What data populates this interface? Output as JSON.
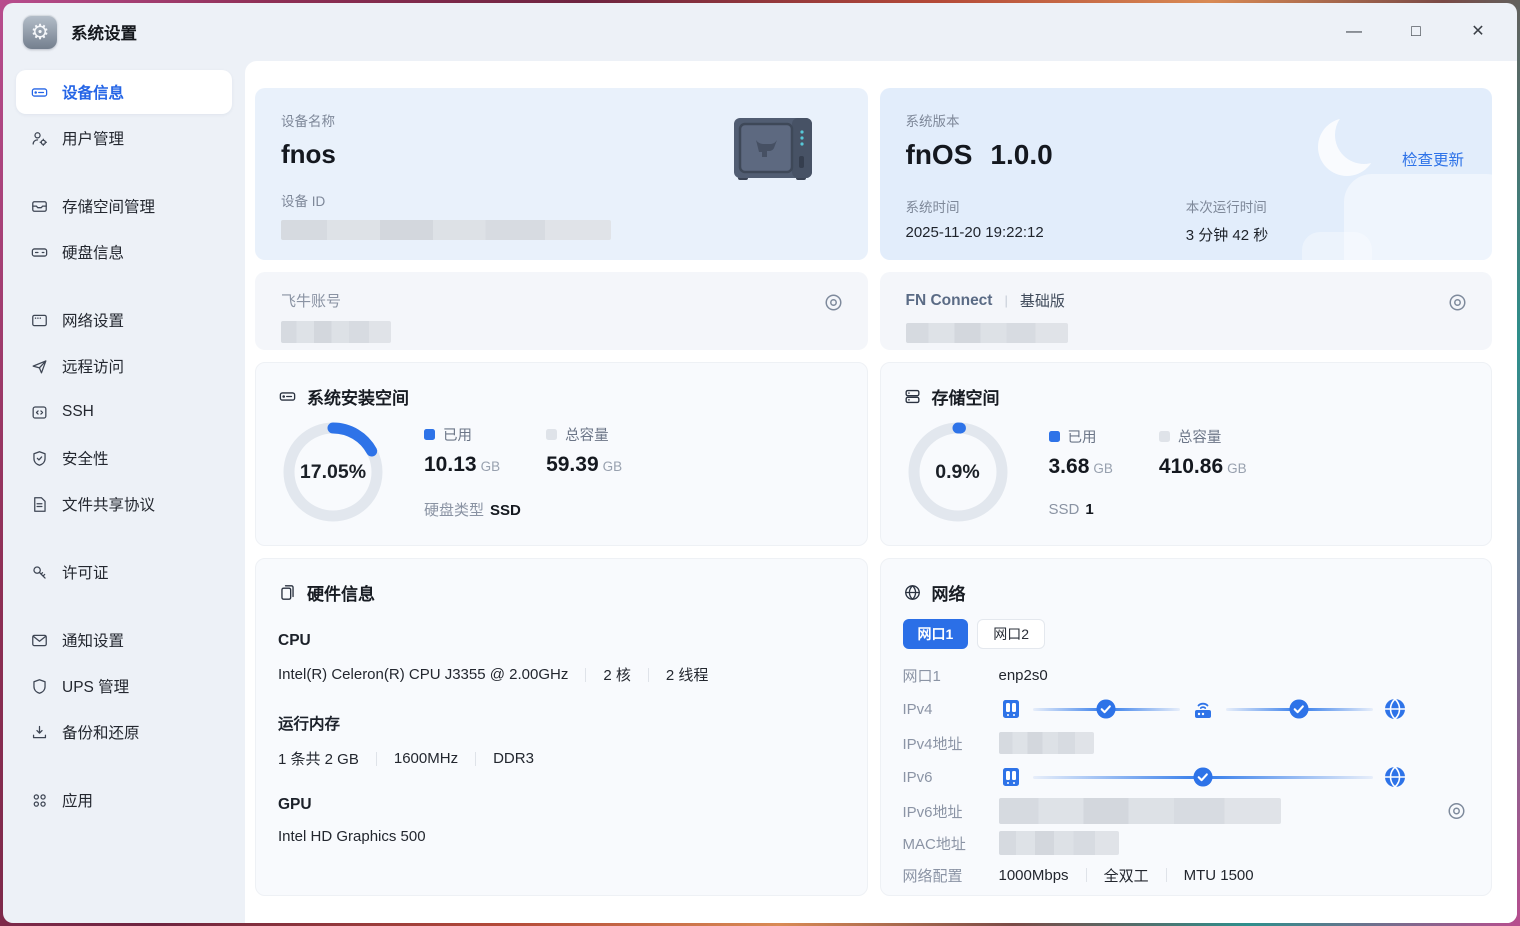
{
  "window": {
    "title": "系统设置",
    "controls": {
      "minimize": "—",
      "maximize": "□",
      "close": "✕"
    }
  },
  "sidebar": {
    "items": [
      {
        "label": "设备信息",
        "active": true
      },
      {
        "label": "用户管理",
        "active": false
      },
      {
        "label": "存储空间管理",
        "active": false
      },
      {
        "label": "硬盘信息",
        "active": false
      },
      {
        "label": "网络设置",
        "active": false
      },
      {
        "label": "远程访问",
        "active": false
      },
      {
        "label": "SSH",
        "active": false
      },
      {
        "label": "安全性",
        "active": false
      },
      {
        "label": "文件共享协议",
        "active": false
      },
      {
        "label": "许可证",
        "active": false
      },
      {
        "label": "通知设置",
        "active": false
      },
      {
        "label": "UPS 管理",
        "active": false
      },
      {
        "label": "备份和还原",
        "active": false
      },
      {
        "label": "应用",
        "active": false
      }
    ]
  },
  "main": {
    "device_card": {
      "name_label": "设备名称",
      "name": "fnos",
      "id_label": "设备 ID"
    },
    "version_card": {
      "label": "系统版本",
      "os": "fnOS",
      "version": "1.0.0",
      "update_label": "检查更新",
      "time_label": "系统时间",
      "time": "2025-11-20 19:22:12",
      "uptime_label": "本次运行时间",
      "uptime": "3 分钟 42 秒"
    },
    "account_card": {
      "label": "飞牛账号"
    },
    "connect_card": {
      "name": "FN Connect",
      "tier": "基础版"
    },
    "sys_space": {
      "title": "系统安装空间",
      "percent_text": "17.05%",
      "percent_value": 17.05,
      "used_label": "已用",
      "used_value": "10.13",
      "used_unit": "GB",
      "total_label": "总容量",
      "total_value": "59.39",
      "total_unit": "GB",
      "disk_type_label": "硬盘类型",
      "disk_type": "SSD"
    },
    "storage": {
      "title": "存储空间",
      "percent_text": "0.9%",
      "percent_value": 0.9,
      "used_label": "已用",
      "used_value": "3.68",
      "used_unit": "GB",
      "total_label": "总容量",
      "total_value": "410.86",
      "total_unit": "GB",
      "ssd_label": "SSD",
      "ssd_count": "1"
    },
    "hardware": {
      "title": "硬件信息",
      "cpu_label": "CPU",
      "cpu_model": "Intel(R) Celeron(R) CPU J3355 @ 2.00GHz",
      "cpu_cores": "2 核",
      "cpu_threads": "2 线程",
      "ram_label": "运行内存",
      "ram_size": "1 条共 2 GB",
      "ram_freq": "1600MHz",
      "ram_type": "DDR3",
      "gpu_label": "GPU",
      "gpu_model": "Intel HD Graphics 500"
    },
    "network": {
      "title": "网络",
      "tabs": [
        "网口1",
        "网口2"
      ],
      "port_label": "网口1",
      "port_value": "enp2s0",
      "ipv4_label": "IPv4",
      "ipv4_addr_label": "IPv4地址",
      "ipv6_label": "IPv6",
      "ipv6_addr_label": "IPv6地址",
      "mac_label": "MAC地址",
      "config_label": "网络配置",
      "speed": "1000Mbps",
      "duplex": "全双工",
      "mtu": "MTU 1500"
    }
  },
  "colors": {
    "accent": "#2b6fe7",
    "donut_used": "#2e73e8",
    "donut_track": "#e2e7ee",
    "link": "#2e73e8",
    "tab_active_bg": "#2b6fe7",
    "sidebar_active_text": "#2565e6"
  }
}
